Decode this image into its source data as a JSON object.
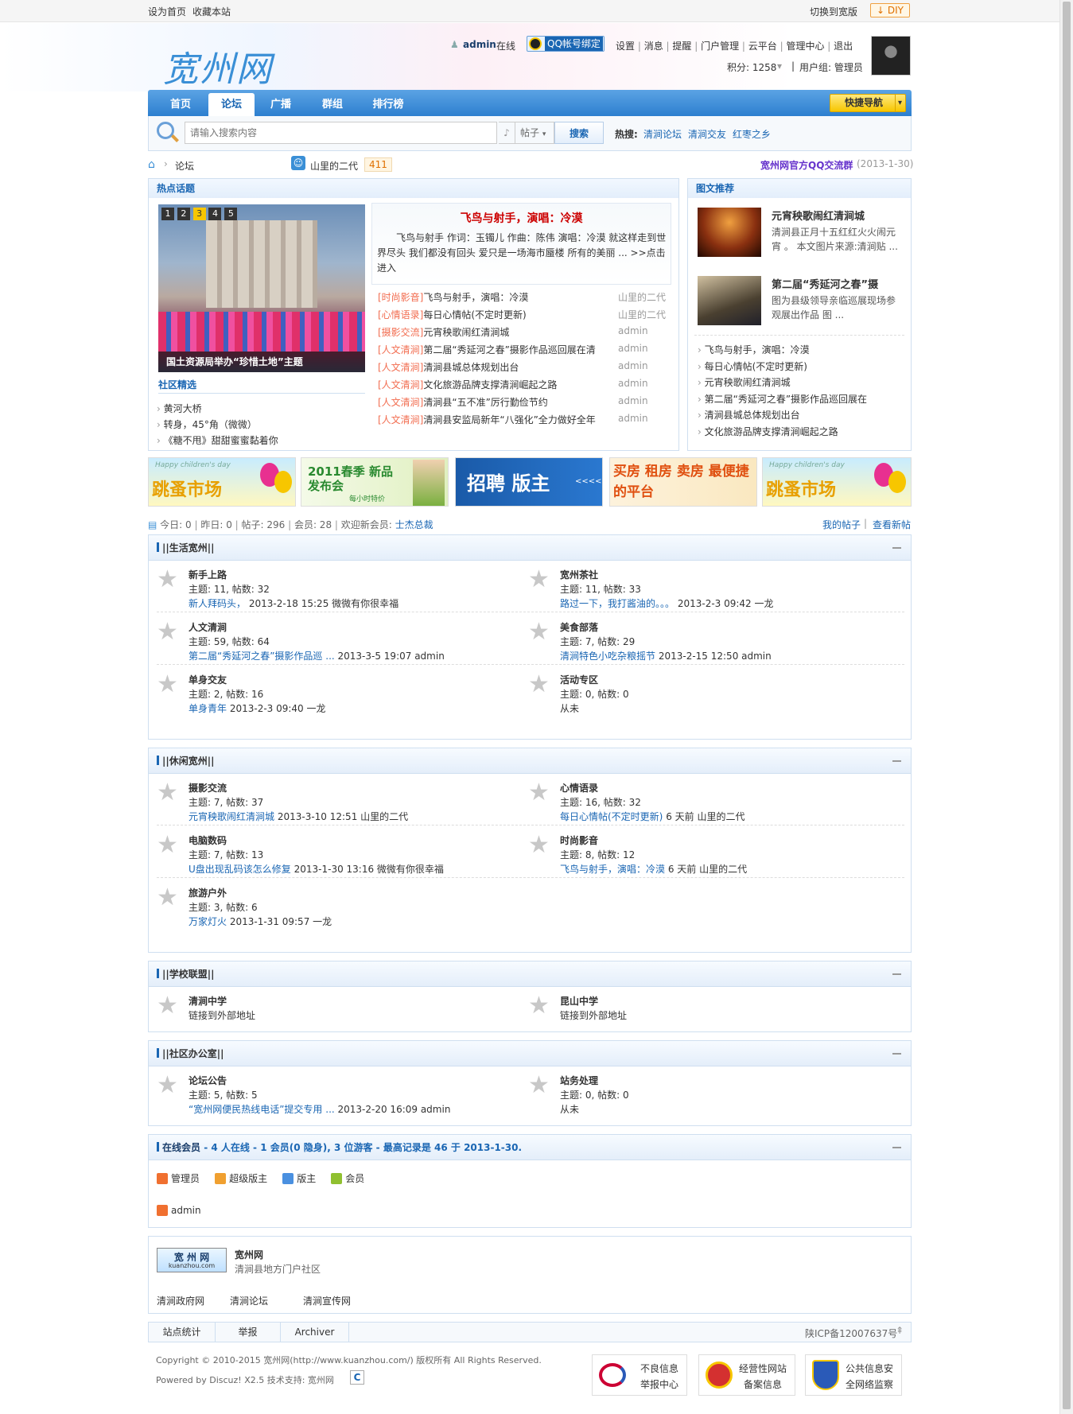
{
  "topbar": {
    "set_home": "设为首页",
    "bookmark": "收藏本站",
    "switch_wide": "切换到宽版",
    "diy": "DIY"
  },
  "site": {
    "logo": "宽州网"
  },
  "user": {
    "name": "admin",
    "status": "在线",
    "qq_bind": "QQ帐号绑定",
    "links": [
      "设置",
      "消息",
      "提醒",
      "门户管理",
      "云平台",
      "管理中心",
      "退出"
    ],
    "points": "积分: 1258",
    "group": "用户组: 管理员"
  },
  "nav": {
    "items": [
      "首页",
      "论坛",
      "广播",
      "群组",
      "排行榜"
    ],
    "quick": "快捷导航"
  },
  "search": {
    "placeholder": "请输入搜索内容",
    "type": "帖子",
    "button": "搜索",
    "hot_label": "热搜:",
    "hot": [
      "清涧论坛",
      "清涧交友",
      "红枣之乡"
    ]
  },
  "breadcrumb": {
    "forum": "论坛",
    "user": "山里的二代",
    "count": "411",
    "qq_group": "宽州网官方QQ交流群",
    "qq_date": "(2013-1-30)"
  },
  "hot": {
    "title": "热点话题",
    "slides": [
      "1",
      "2",
      "3",
      "4",
      "5"
    ],
    "caption": "国土资源局举办“珍惜土地”主题",
    "featured_title": "飞鸟与射手，演唱：冷漠",
    "featured_text": "飞鸟与射手 作词：玉镯儿 作曲：陈伟 演唱：冷漠 就这样走到世界尽头 我们都没有回头 爱只是一场海市蜃楼 所有的美丽 ... >>点击进入",
    "list": [
      {
        "tag": "[时尚影音]",
        "title": "飞鸟与射手，演唱：冷漠",
        "author": "山里的二代"
      },
      {
        "tag": "[心情语录]",
        "title": "每日心情帖(不定时更新)",
        "author": "山里的二代"
      },
      {
        "tag": "[摄影交流]",
        "title": "元宵秧歌闹红清涧城",
        "author": "admin"
      },
      {
        "tag": "[人文清涧]",
        "title": "第二届“秀延河之春”摄影作品巡回展在清",
        "author": "admin"
      },
      {
        "tag": "[人文清涧]",
        "title": "清涧县城总体规划出台",
        "author": "admin"
      },
      {
        "tag": "[人文清涧]",
        "title": "文化旅游品牌支撑清涧崛起之路",
        "author": "admin"
      },
      {
        "tag": "[人文清涧]",
        "title": "清涧县“五不准”厉行勤俭节约",
        "author": "admin"
      },
      {
        "tag": "[人文清涧]",
        "title": "清涧县安监局新年“八强化”全力做好全年",
        "author": "admin"
      }
    ],
    "community_title": "社区精选",
    "community": [
      "黄河大桥",
      "转身，45°角（微微）",
      "《糖不甩》甜甜蜜蜜黏着你"
    ]
  },
  "pics": {
    "title": "图文推荐",
    "items": [
      {
        "title": "元宵秧歌闹红清涧城",
        "desc": "清涧县正月十五红红火火闹元宵 。 本文图片来源:清涧贴 ..."
      },
      {
        "title": "第二届“秀延河之春”摄",
        "desc": "图为县级领导亲临巡展现场参观展出作品 图 ..."
      }
    ],
    "list": [
      "飞鸟与射手，演唱：冷漠",
      "每日心情帖(不定时更新)",
      "元宵秧歌闹红清涧城",
      "第二届“秀延河之春”摄影作品巡回展在",
      "清涧县城总体规划出台",
      "文化旅游品牌支撑清涧崛起之路"
    ]
  },
  "banners": [
    {
      "text": "跳蚤市场",
      "sub": "Happy children's day"
    },
    {
      "text": "2011春季 新品发布会",
      "sub": "每小时特价"
    },
    {
      "text": "招聘 版主",
      "sub": "<<<<"
    },
    {
      "text": "买房 租房 卖房 最便捷的平台",
      "sub": ""
    },
    {
      "text": "跳蚤市场",
      "sub": "Happy children's day"
    }
  ],
  "stats": {
    "today": "今日: 0",
    "yesterday": "昨日: 0",
    "posts": "帖子: 296",
    "members": "会员: 28",
    "welcome": "欢迎新会员:",
    "new_member": "士杰总裁",
    "my_posts": "我的帖子",
    "new_posts": "查看新帖"
  },
  "sections": [
    {
      "title": "||生活宽州||",
      "forums": [
        {
          "name": "新手上路",
          "stat": "主题: 11, 帖数: 32",
          "last_link": "新人拜码头，",
          "last_rest": " 2013-2-18 15:25 微微有你很幸福"
        },
        {
          "name": "宽州茶社",
          "stat": "主题: 11, 帖数: 33",
          "last_link": "路过一下，我打酱油的。。。",
          "last_rest": " 2013-2-3 09:42 一龙"
        },
        {
          "name": "人文清涧",
          "stat": "主题: 59, 帖数: 64",
          "last_link": "第二届“秀延河之春”摄影作品巡 ...",
          "last_rest": " 2013-3-5 19:07 admin"
        },
        {
          "name": "美食部落",
          "stat": "主题: 7, 帖数: 29",
          "last_link": "清涧特色小吃杂粮摇节",
          "last_rest": " 2013-2-15 12:50 admin"
        },
        {
          "name": "单身交友",
          "stat": "主题: 2, 帖数: 16",
          "last_link": "单身青年",
          "last_rest": " 2013-2-3 09:40 一龙"
        },
        {
          "name": "活动专区",
          "stat": "主题: 0, 帖数: 0",
          "last_link": "",
          "last_rest": "从未"
        }
      ]
    },
    {
      "title": "||休闲宽州||",
      "forums": [
        {
          "name": "摄影交流",
          "stat": "主题: 7, 帖数: 37",
          "last_link": "元宵秧歌闹红清涧城",
          "last_rest": " 2013-3-10 12:51 山里的二代"
        },
        {
          "name": "心情语录",
          "stat": "主题: 16, 帖数: 32",
          "last_link": "每日心情帖(不定时更新)",
          "last_rest": " 6 天前 山里的二代"
        },
        {
          "name": "电脑数码",
          "stat": "主题: 7, 帖数: 13",
          "last_link": "U盘出现乱码该怎么修复",
          "last_rest": " 2013-1-30 13:16 微微有你很幸福"
        },
        {
          "name": "时尚影音",
          "stat": "主题: 8, 帖数: 12",
          "last_link": "飞鸟与射手，演唱：冷漠",
          "last_rest": " 6 天前 山里的二代"
        },
        {
          "name": "旅游户外",
          "stat": "主题: 3, 帖数: 6",
          "last_link": "万家灯火",
          "last_rest": " 2013-1-31 09:57 一龙"
        }
      ]
    },
    {
      "title": "||学校联盟||",
      "forums": [
        {
          "name": "清涧中学",
          "stat": "",
          "last_link": "链接到外部地址",
          "last_rest": ""
        },
        {
          "name": "昆山中学",
          "stat": "",
          "last_link": "链接到外部地址",
          "last_rest": ""
        }
      ]
    },
    {
      "title": "||社区办公室||",
      "forums": [
        {
          "name": "论坛公告",
          "stat": "主题: 5, 帖数: 5",
          "last_link": "“宽州网便民热线电话”提交专用 ...",
          "last_rest": " 2013-2-20 16:09 admin"
        },
        {
          "name": "站务处理",
          "stat": "主题: 0, 帖数: 0",
          "last_link": "",
          "last_rest": "从未"
        }
      ]
    }
  ],
  "online": {
    "label": "在线会员",
    "summary": " - 4 人在线 - 1 会员(0 隐身), 3 位游客 - 最高记录是 46 于 2013-1-30.",
    "legend": [
      "管理员",
      "超级版主",
      "版主",
      "会员"
    ],
    "users": [
      "admin"
    ]
  },
  "links_box": {
    "logo": "宽 州 网",
    "logo_sub": "kuanzhou.com",
    "name": "宽州网",
    "desc": "清涧县地方门户社区",
    "links": [
      "清涧政府网",
      "清涧论坛",
      "清涧宣传网"
    ]
  },
  "footer": {
    "links": [
      "站点统计",
      "举报",
      "Archiver"
    ],
    "icp": "陕ICP备12007637号",
    "copyright": "Copyright © 2010-2015 宽州网(http://www.kuanzhou.com/) 版权所有 All Rights Reserved.",
    "powered": "Powered by Discuz! X2.5 技术支持: 宽州网",
    "badges": [
      [
        "不良信息",
        "举报中心"
      ],
      [
        "经营性网站",
        "备案信息"
      ],
      [
        "公共信息安",
        "全网络监察"
      ]
    ]
  },
  "colors": {
    "accent": "#1a66b3",
    "nav": "#2d7fcf",
    "tag": "#f26c4f",
    "quick": "#f7c600"
  }
}
